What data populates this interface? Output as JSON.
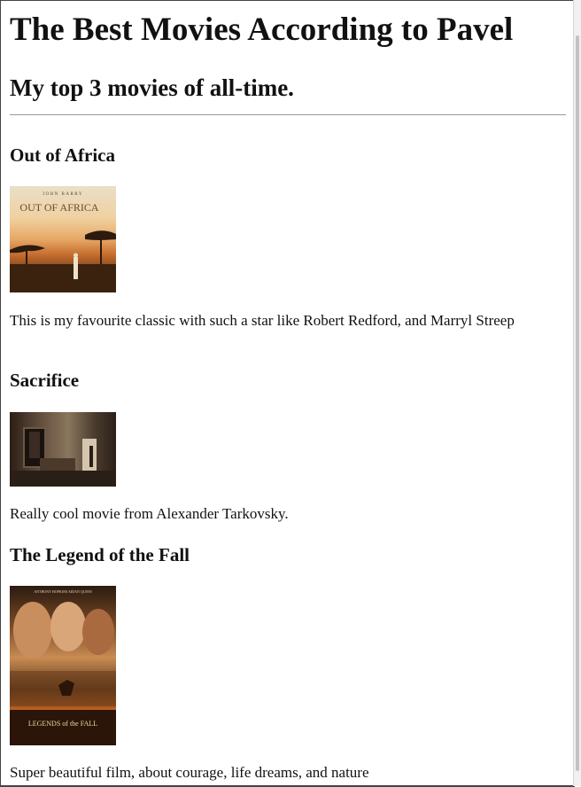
{
  "page": {
    "title": "The Best Movies According to Pavel",
    "subtitle": "My top 3 movies of all-time."
  },
  "movies": [
    {
      "title": "Out of Africa",
      "poster_text_top": "JOHN BARRY",
      "poster_text_main": "OUT OF AFRICA",
      "description": "This is my favourite classic with such a star like Robert Redford, and Marryl Streep"
    },
    {
      "title": "Sacrifice",
      "description": "Really cool movie from Alexander Tarkovsky."
    },
    {
      "title": "The Legend of the Fall",
      "poster_text_top": "ANTHONY HOPKINS   AIDAN QUINN",
      "poster_text_main": "LEGENDS of the FALL",
      "description": "Super beautiful film, about courage, life dreams, and nature"
    }
  ]
}
